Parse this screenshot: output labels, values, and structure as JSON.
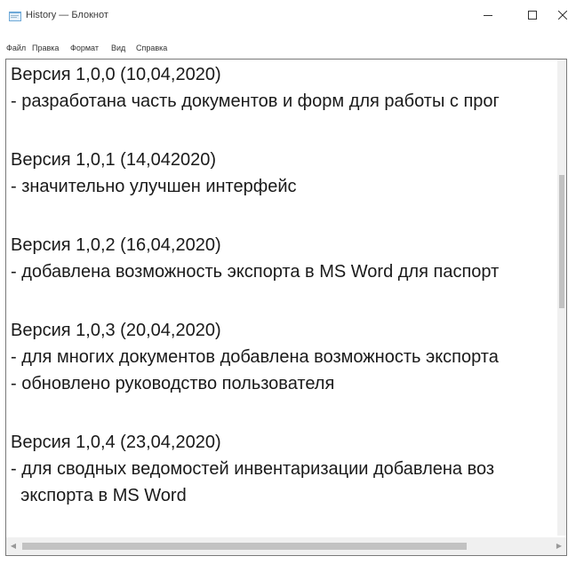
{
  "window": {
    "title": "History — Блокнот",
    "icon": "notepad-icon"
  },
  "controls": {
    "minimize_icon": "minimize-icon",
    "maximize_icon": "maximize-icon",
    "close_icon": "close-icon"
  },
  "menu": {
    "items": [
      {
        "label": "Файл"
      },
      {
        "label": "Правка"
      },
      {
        "label": "Формат"
      },
      {
        "label": "Вид"
      },
      {
        "label": "Справка"
      }
    ]
  },
  "editor": {
    "lines": [
      "Версия 1,0,0 (10,04,2020)",
      "- разработана часть документов и форм для работы с прог",
      "",
      "Версия 1,0,1 (14,042020)",
      "- значительно улучшен интерфейс",
      "",
      "Версия 1,0,2 (16,04,2020)",
      "- добавлена возможность экспорта в MS Word для паспорт",
      "",
      "Версия 1,0,3 (20,04,2020)",
      "- для многих документов добавлена возможность экспорта",
      "- обновлено руководство пользователя",
      "",
      "Версия 1,0,4 (23,04,2020)",
      "- для сводных ведомостей инвентаризации добавлена воз",
      "  экспорта в MS Word"
    ]
  },
  "colors": {
    "background": "#ffffff",
    "text": "#1a1a1a",
    "scrollbar_track": "#f0f0f0",
    "scrollbar_thumb": "#c2c2c2"
  }
}
